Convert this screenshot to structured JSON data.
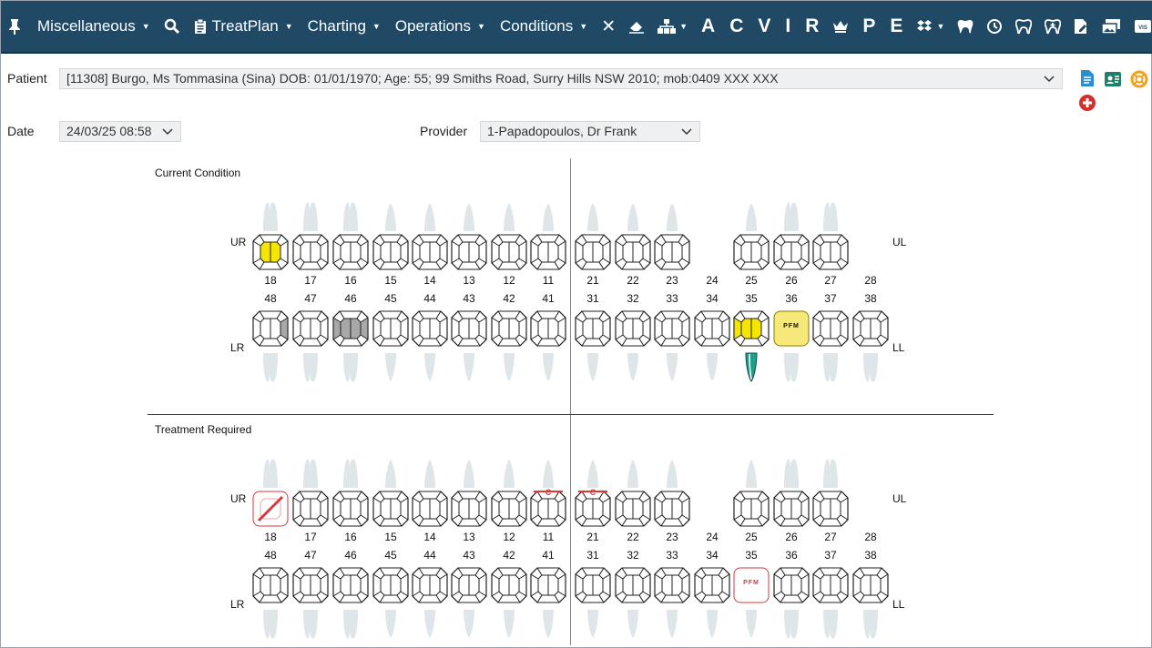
{
  "toolbar": {
    "menus": [
      {
        "label": "Miscellaneous",
        "icon": "pin-icon"
      },
      {
        "label": "TreatPlan",
        "icon": "clipboard-icon"
      },
      {
        "label": "Charting"
      },
      {
        "label": "Operations"
      },
      {
        "label": "Conditions"
      }
    ],
    "letters": [
      "A",
      "C",
      "V",
      "I",
      "R",
      "P",
      "E"
    ]
  },
  "patient": {
    "label": "Patient",
    "value": "[11308] Burgo, Ms Tommasina (Sina) DOB: 01/01/1970; Age: 55; 99 Smiths Road, Surry Hills NSW 2010; mob:0409 XXX XXX"
  },
  "date": {
    "label": "Date",
    "value": "24/03/25 08:58"
  },
  "provider": {
    "label": "Provider",
    "value": "1-Papadopoulos, Dr Frank"
  },
  "sections": {
    "current": "Current Condition",
    "treatment": "Treatment Required"
  },
  "quadrants": {
    "ur": "UR",
    "ul": "UL",
    "lr": "LR",
    "ll": "LL"
  },
  "upper_teeth": [
    "18",
    "17",
    "16",
    "15",
    "14",
    "13",
    "12",
    "11",
    "21",
    "22",
    "23",
    "24",
    "25",
    "26",
    "27",
    "28"
  ],
  "lower_teeth": [
    "48",
    "47",
    "46",
    "45",
    "44",
    "43",
    "42",
    "41",
    "31",
    "32",
    "33",
    "34",
    "35",
    "36",
    "37",
    "38"
  ],
  "missing_teeth": [
    "24",
    "28"
  ],
  "current_condition": {
    "18": {
      "type": "filling-occlusal",
      "color": "#f5e500"
    },
    "48": {
      "type": "filling-distal",
      "color": "#a8a8a8"
    },
    "46": {
      "type": "filling-mesial-distal",
      "color": "#a8a8a8"
    },
    "35": {
      "type": "filling-occlusal-mesial",
      "color": "#f5e500",
      "root_canal": true
    },
    "36": {
      "type": "crown",
      "label": "PFM",
      "color": "#f7e87a"
    }
  },
  "treatment_required": {
    "18": {
      "type": "extraction",
      "color": "#d63a3a"
    },
    "11": {
      "type": "mark",
      "label": "C",
      "color": "#d63a3a"
    },
    "21": {
      "type": "mark",
      "label": "C",
      "color": "#d63a3a"
    },
    "35": {
      "type": "crown-planned",
      "label": "PFM",
      "color": "#d63a3a"
    }
  },
  "colors": {
    "toolbar": "#1f4964",
    "root": "#dfe6ea"
  }
}
